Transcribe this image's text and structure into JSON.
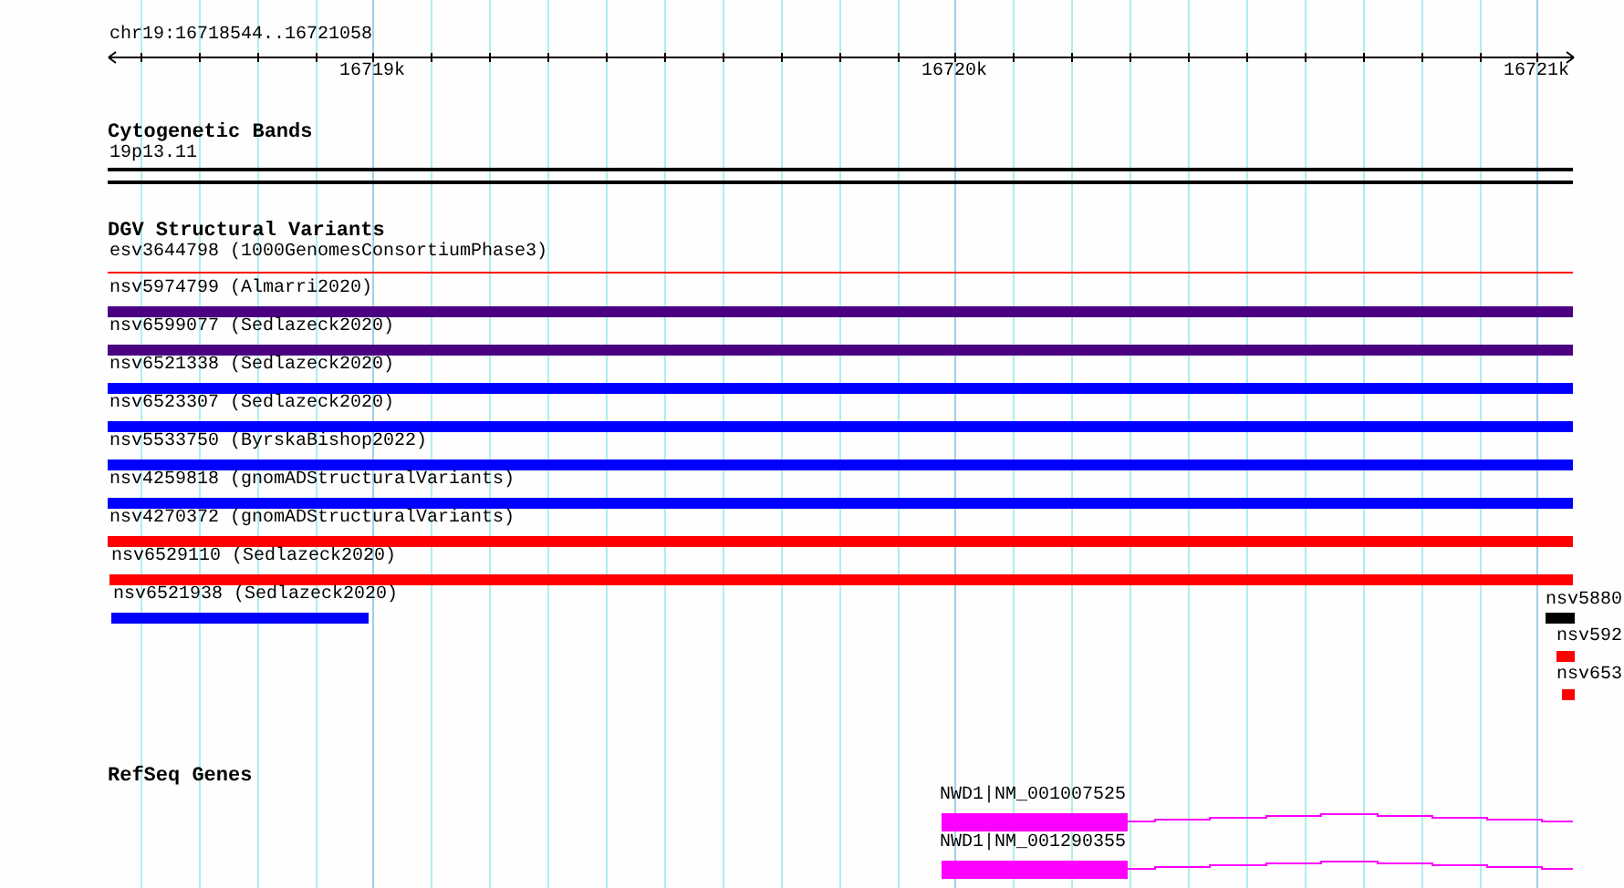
{
  "ruler": {
    "region": "chr19:16718544..16721058",
    "ticks": [
      {
        "label": "16719k"
      },
      {
        "label": "16720k"
      },
      {
        "label": "16721k"
      }
    ]
  },
  "tracks": [
    {
      "title": "Cytogenetic Bands",
      "features": [
        {
          "label": "19p13.11",
          "kind": "band",
          "color": "#000000"
        }
      ]
    },
    {
      "title": "DGV Structural Variants",
      "features": [
        {
          "label": "esv3644798 (1000GenomesConsortiumPhase3)",
          "kind": "line",
          "color": "#ff0000"
        },
        {
          "label": "nsv5974799 (Almarri2020)",
          "kind": "bar",
          "color": "#4b0082"
        },
        {
          "label": "nsv6599077 (Sedlazeck2020)",
          "kind": "bar",
          "color": "#4b0082"
        },
        {
          "label": "nsv6521338 (Sedlazeck2020)",
          "kind": "bar",
          "color": "#0000ff"
        },
        {
          "label": "nsv6523307 (Sedlazeck2020)",
          "kind": "bar",
          "color": "#0000ff"
        },
        {
          "label": "nsv5533750 (ByrskaBishop2022)",
          "kind": "bar",
          "color": "#0000ff"
        },
        {
          "label": "nsv4259818 (gnomADStructuralVariants)",
          "kind": "bar",
          "color": "#0000ff"
        },
        {
          "label": "nsv4270372 (gnomADStructuralVariants)",
          "kind": "bar",
          "color": "#ff0000"
        },
        {
          "label": "nsv6529110 (Sedlazeck2020)",
          "kind": "bar",
          "color": "#ff0000"
        },
        {
          "label": "nsv6521938 (Sedlazeck2020)",
          "kind": "bar",
          "color": "#0000ff"
        },
        {
          "label": "nsv5880",
          "kind": "bar",
          "color": "#000000"
        },
        {
          "label": "nsv592",
          "kind": "bar",
          "color": "#ff0000"
        },
        {
          "label": "nsv653",
          "kind": "bar",
          "color": "#ff0000"
        }
      ]
    },
    {
      "title": "RefSeq Genes",
      "features": [
        {
          "label": "NWD1|NM_001007525",
          "kind": "gene",
          "color": "#ff00ff"
        },
        {
          "label": "NWD1|NM_001290355",
          "kind": "gene",
          "color": "#ff00ff"
        }
      ]
    }
  ]
}
